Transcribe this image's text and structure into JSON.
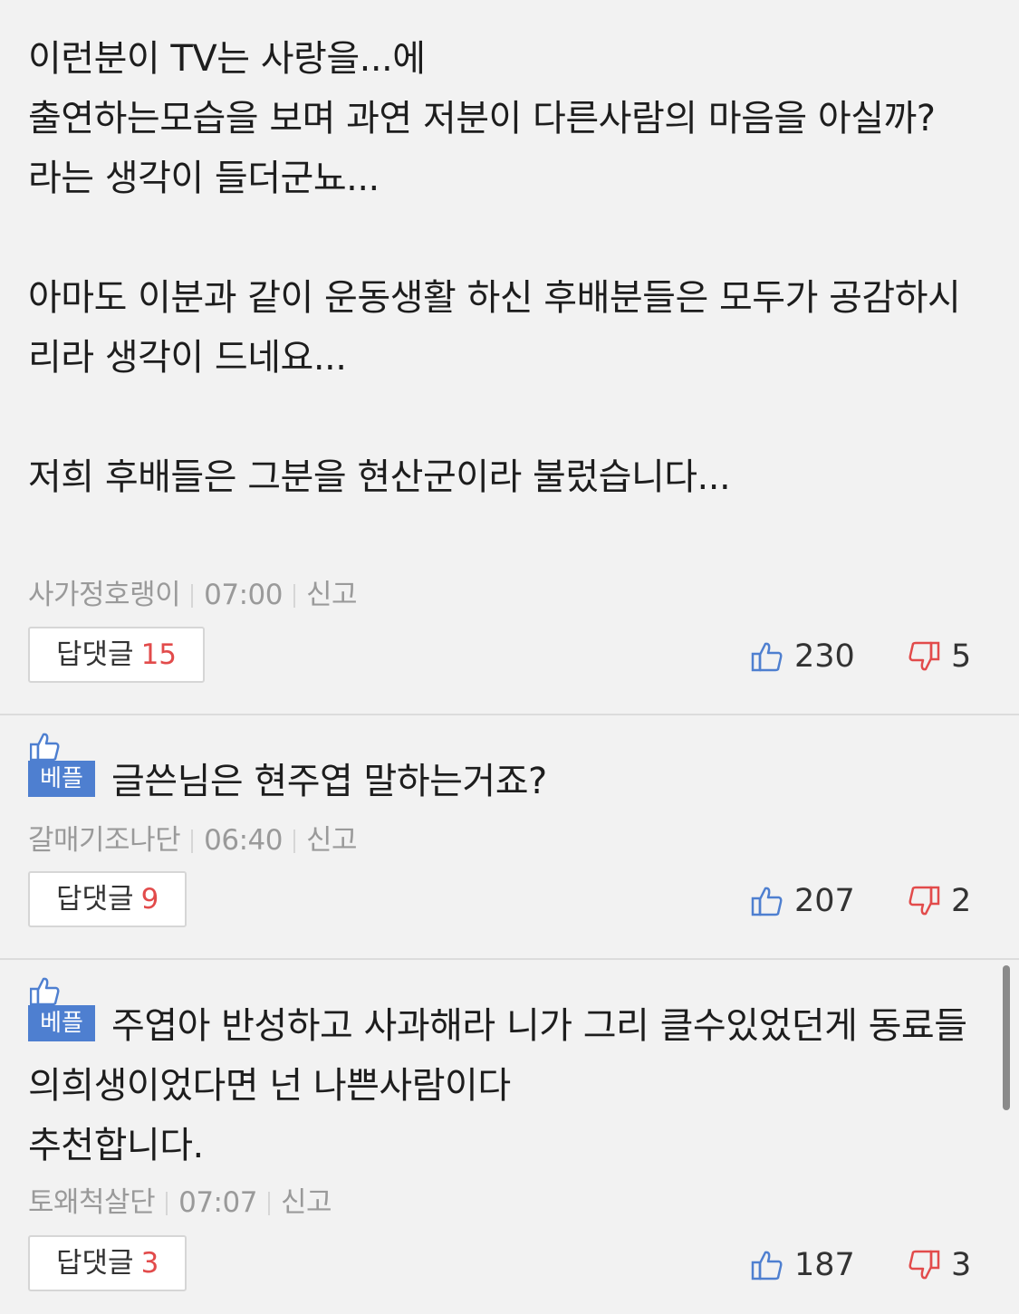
{
  "comments": [
    {
      "best": false,
      "text": "이런분이 TV는 사랑을...에\n출연하는모습을 보며 과연 저분이 다른사람의 마음을 아실까?\n라는 생각이 들더군뇨...\n\n아마도 이분과 같이 운동생활 하신 후배분들은 모두가 공감하시리라 생각이 드네요...\n\n저희 후배들은 그분을 현산군이라 불렀습니다...",
      "author": "사가정호랭이",
      "time": "07:00",
      "report": "신고",
      "reply_label": "답댓글",
      "reply_count": "15",
      "likes": "230",
      "dislikes": "5"
    },
    {
      "best": true,
      "best_label": "베플",
      "text": "글쓴님은 현주엽 말하는거죠?",
      "author": "갈매기조나단",
      "time": "06:40",
      "report": "신고",
      "reply_label": "답댓글",
      "reply_count": "9",
      "likes": "207",
      "dislikes": "2"
    },
    {
      "best": true,
      "best_label": "베플",
      "text": "주엽아 반성하고 사과해라 니가 그리 클수있었던게 동료들의희생이었다면 넌 나쁜사람이다\n추천합니다.",
      "author": "토왜척살단",
      "time": "07:07",
      "report": "신고",
      "reply_label": "답댓글",
      "reply_count": "3",
      "likes": "187",
      "dislikes": "3"
    }
  ],
  "colors": {
    "background": "#f2f2f2",
    "best_badge": "#4e7fd0",
    "reply_count": "#e24b4b",
    "like_icon": "#4e7fd0",
    "dislike_icon": "#e24b4b"
  },
  "icons": {
    "like": "thumbs-up-icon",
    "dislike": "thumbs-down-icon",
    "best": "best-thumb-icon"
  }
}
